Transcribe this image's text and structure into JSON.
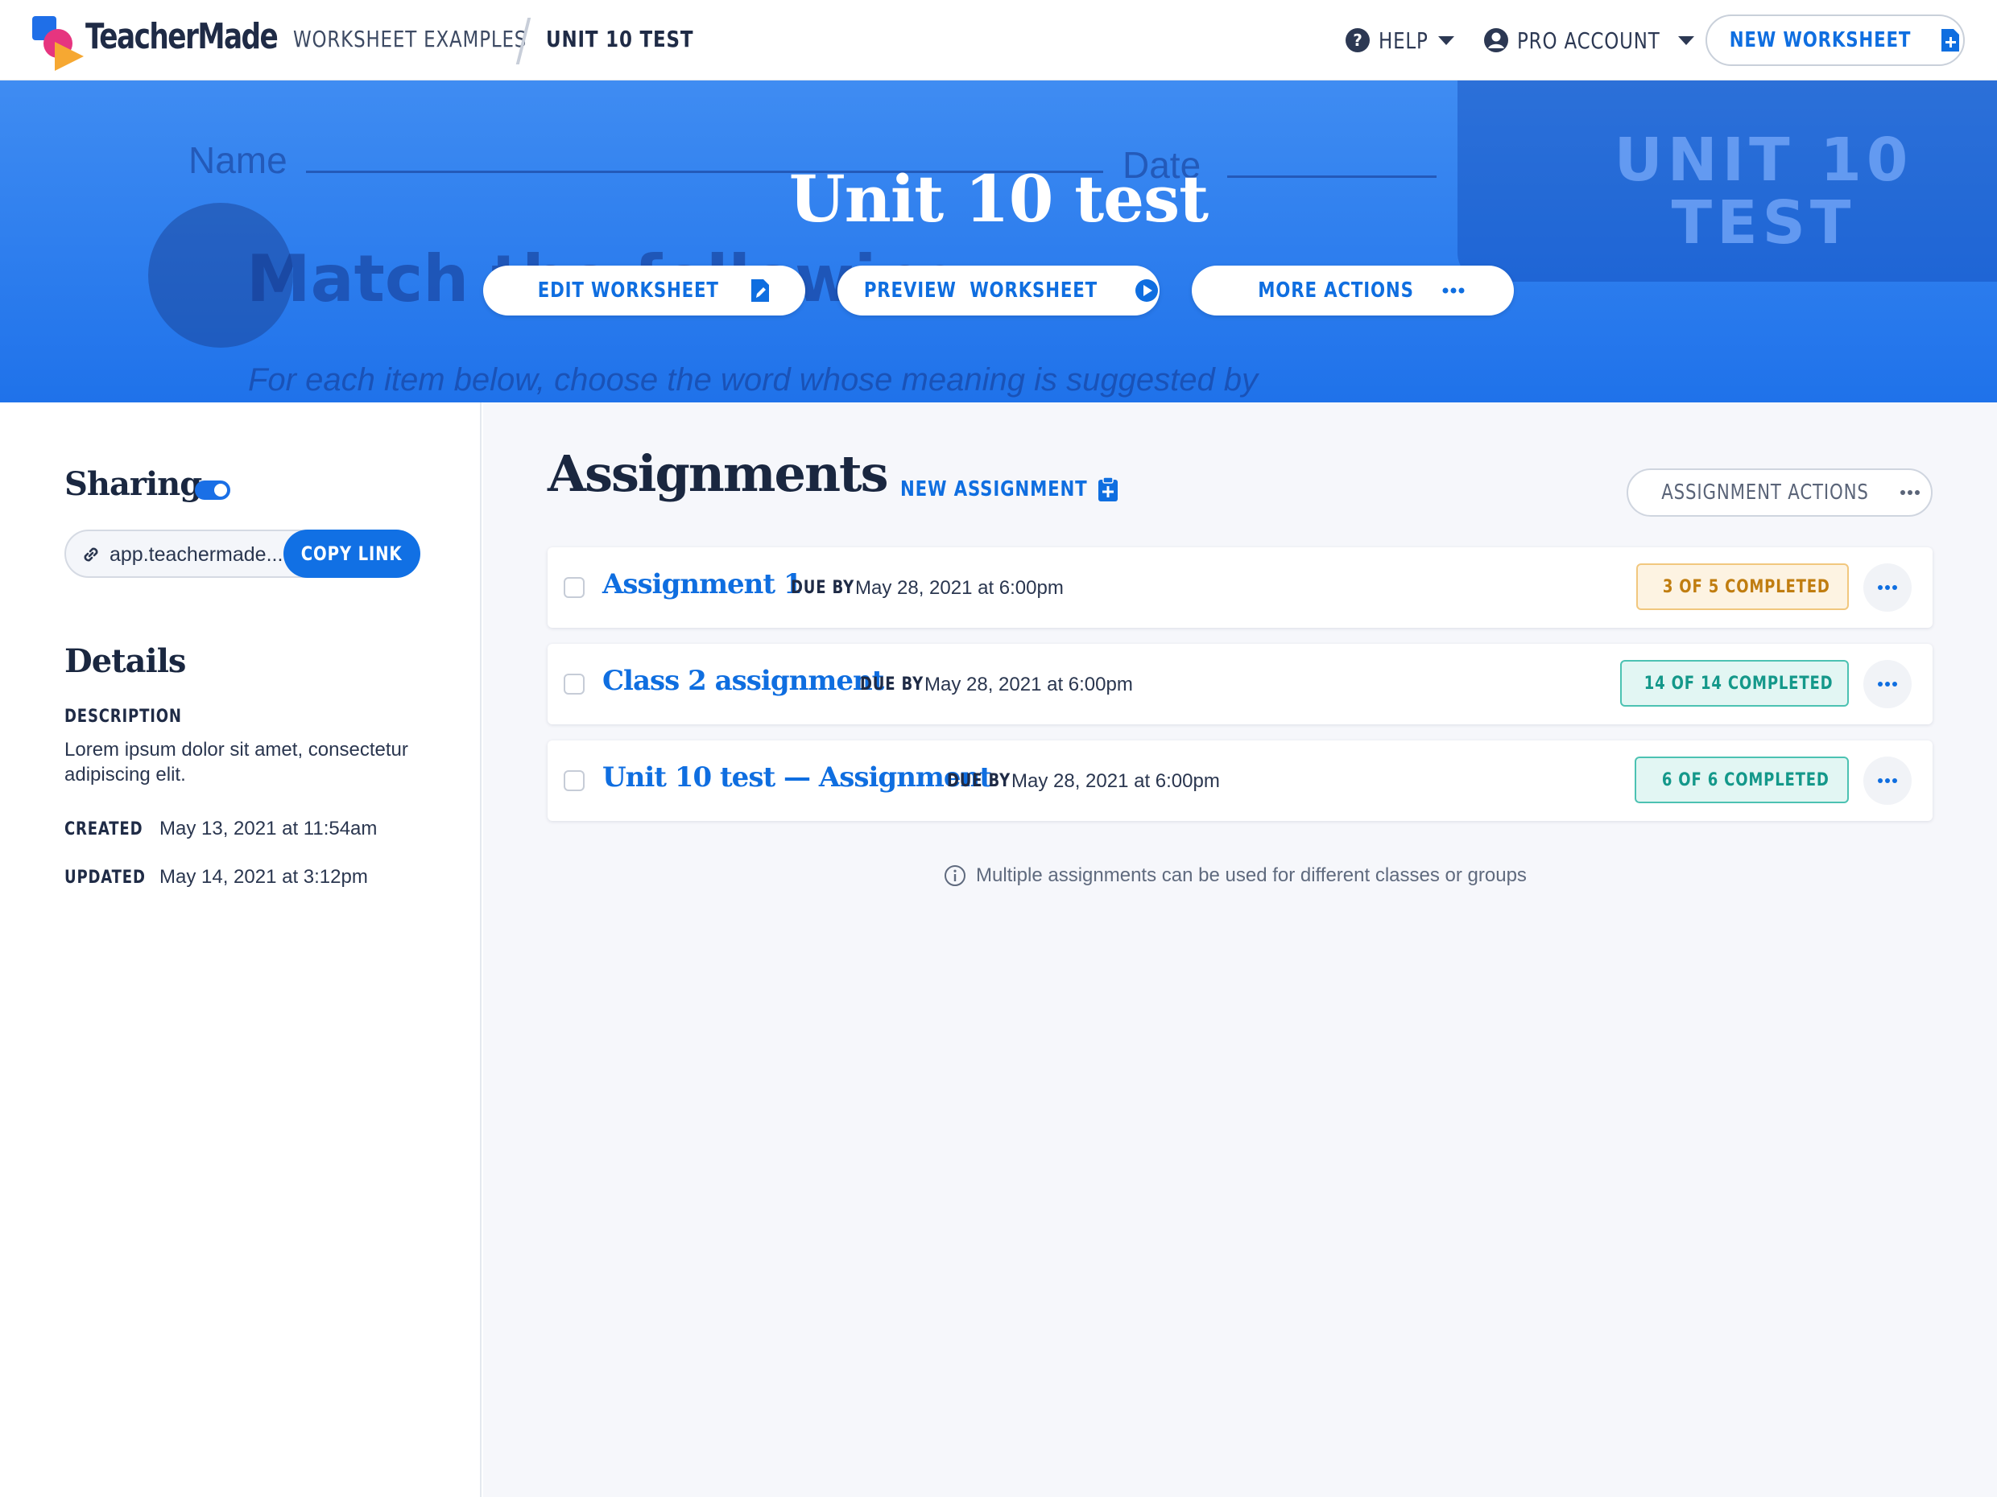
{
  "nav": {
    "brand": "TeacherMade",
    "breadcrumb": [
      "WORKSHEET EXAMPLES",
      "UNIT 10 TEST"
    ],
    "help_label": "HELP",
    "account_label": "PRO ACCOUNT",
    "new_worksheet_label": "NEW WORKSHEET"
  },
  "hero": {
    "title": "Unit 10 test",
    "background_text": {
      "name": "Name",
      "date": "Date",
      "match": "Match the following",
      "instructions": "For each item below, choose the word whose meaning is suggested by",
      "stamp": "UNIT 10 TEST"
    },
    "buttons": {
      "edit": "EDIT WORKSHEET",
      "preview": "PREVIEW  WORKSHEET",
      "more": "MORE ACTIONS"
    }
  },
  "sidebar": {
    "sharing_heading": "Sharing",
    "sharing_enabled": true,
    "share_url": "app.teachermade...",
    "copy_link_label": "COPY LINK",
    "details_heading": "Details",
    "description_label": "DESCRIPTION",
    "description": "Lorem ipsum dolor sit amet, consectetur adipiscing elit.",
    "created_label": "CREATED",
    "created_value": "May 13, 2021 at 11:54am",
    "updated_label": "UPDATED",
    "updated_value": "May 14, 2021 at 3:12pm"
  },
  "main": {
    "heading": "Assignments",
    "new_assignment_label": "NEW ASSIGNMENT",
    "assignment_actions_label": "ASSIGNMENT ACTIONS",
    "due_label": "DUE BY",
    "assignments": [
      {
        "title": "Assignment 1",
        "due": "May 28, 2021 at 6:00pm",
        "status": "3 OF 5 COMPLETED",
        "state": "pending"
      },
      {
        "title": "Class 2 assignment",
        "due": "May 28, 2021 at 6:00pm",
        "status": "14 OF 14 COMPLETED",
        "state": "done"
      },
      {
        "title": "Unit 10 test — Assignment",
        "due": "May 28, 2021 at 6:00pm",
        "status": "6 OF 6 COMPLETED",
        "state": "done"
      }
    ],
    "hint": "Multiple assignments can be used for different classes or groups"
  },
  "colors": {
    "accent": "#0f6ee0",
    "hero": "#2b7cf0",
    "pending": "#c07d10",
    "done": "#14988a"
  }
}
